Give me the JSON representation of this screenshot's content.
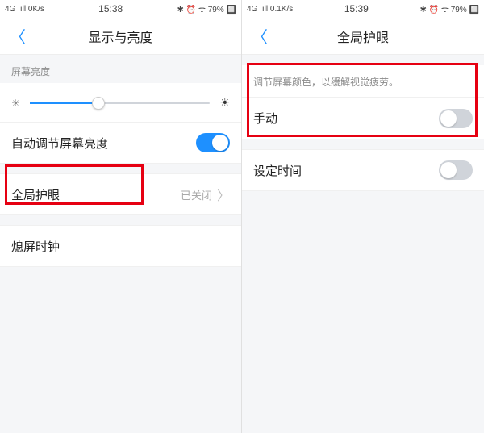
{
  "left": {
    "status": {
      "net": "4G ııll 0K/s",
      "time": "15:38",
      "right": "✱ ⏰ ᯤ 79% 🔲"
    },
    "nav": {
      "title": "显示与亮度"
    },
    "brightness": {
      "section": "屏幕亮度"
    },
    "rows": {
      "auto": "自动调节屏幕亮度",
      "eye": {
        "label": "全局护眼",
        "value": "已关闭"
      },
      "clock": "熄屏时钟"
    }
  },
  "right": {
    "status": {
      "net": "4G ııll 0.1K/s",
      "time": "15:39",
      "right": "✱ ⏰ ᯤ 79% 🔲"
    },
    "nav": {
      "title": "全局护眼"
    },
    "desc": "调节屏幕颜色，以缓解视觉疲劳。",
    "rows": {
      "manual": "手动",
      "schedule": "设定时间"
    }
  }
}
